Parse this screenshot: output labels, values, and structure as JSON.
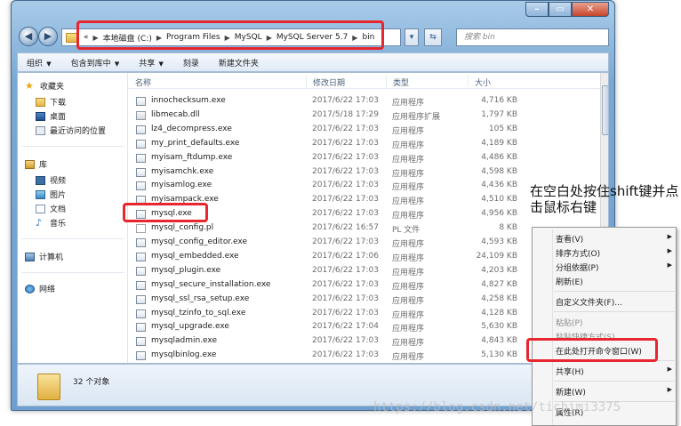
{
  "breadcrumb": [
    "本地磁盘 (C:)",
    "Program Files",
    "MySQL",
    "MySQL Server 5.7",
    "bin"
  ],
  "breadcrumb_overflow": "«",
  "search_placeholder": "搜索 bin",
  "toolbar": {
    "organize": "组织",
    "include_library": "包含到库中",
    "share": "共享",
    "burn": "刻录",
    "new_folder": "新建文件夹"
  },
  "nav": {
    "favorites": "收藏夹",
    "downloads": "下载",
    "desktop": "桌面",
    "recent": "最近访问的位置",
    "libraries": "库",
    "videos": "视频",
    "pictures": "图片",
    "documents": "文档",
    "music": "音乐",
    "computer": "计算机",
    "network": "网络"
  },
  "columns": {
    "name": "名称",
    "date": "修改日期",
    "type": "类型",
    "size": "大小"
  },
  "files": [
    {
      "name": "innochecksum.exe",
      "date": "2017/6/22 17:03",
      "type": "应用程序",
      "size": "4,716 KB",
      "icon": "exe"
    },
    {
      "name": "libmecab.dll",
      "date": "2017/5/18 17:29",
      "type": "应用程序扩展",
      "size": "1,797 KB",
      "icon": "dll"
    },
    {
      "name": "lz4_decompress.exe",
      "date": "2017/6/22 17:03",
      "type": "应用程序",
      "size": "105 KB",
      "icon": "exe"
    },
    {
      "name": "my_print_defaults.exe",
      "date": "2017/6/22 17:03",
      "type": "应用程序",
      "size": "4,189 KB",
      "icon": "exe"
    },
    {
      "name": "myisam_ftdump.exe",
      "date": "2017/6/22 17:03",
      "type": "应用程序",
      "size": "4,486 KB",
      "icon": "exe"
    },
    {
      "name": "myisamchk.exe",
      "date": "2017/6/22 17:03",
      "type": "应用程序",
      "size": "4,598 KB",
      "icon": "exe"
    },
    {
      "name": "myisamlog.exe",
      "date": "2017/6/22 17:03",
      "type": "应用程序",
      "size": "4,436 KB",
      "icon": "exe"
    },
    {
      "name": "myisampack.exe",
      "date": "2017/6/22 17:03",
      "type": "应用程序",
      "size": "4,510 KB",
      "icon": "exe"
    },
    {
      "name": "mysql.exe",
      "date": "2017/6/22 17:03",
      "type": "应用程序",
      "size": "4,956 KB",
      "icon": "exe"
    },
    {
      "name": "mysql_config.pl",
      "date": "2017/6/22 16:57",
      "type": "PL 文件",
      "size": "8 KB",
      "icon": "pl"
    },
    {
      "name": "mysql_config_editor.exe",
      "date": "2017/6/22 17:03",
      "type": "应用程序",
      "size": "4,593 KB",
      "icon": "exe"
    },
    {
      "name": "mysql_embedded.exe",
      "date": "2017/6/22 17:06",
      "type": "应用程序",
      "size": "24,109 KB",
      "icon": "exe"
    },
    {
      "name": "mysql_plugin.exe",
      "date": "2017/6/22 17:03",
      "type": "应用程序",
      "size": "4,203 KB",
      "icon": "exe"
    },
    {
      "name": "mysql_secure_installation.exe",
      "date": "2017/6/22 17:03",
      "type": "应用程序",
      "size": "4,827 KB",
      "icon": "exe"
    },
    {
      "name": "mysql_ssl_rsa_setup.exe",
      "date": "2017/6/22 17:03",
      "type": "应用程序",
      "size": "4,258 KB",
      "icon": "exe"
    },
    {
      "name": "mysql_tzinfo_to_sql.exe",
      "date": "2017/6/22 17:03",
      "type": "应用程序",
      "size": "4,128 KB",
      "icon": "exe"
    },
    {
      "name": "mysql_upgrade.exe",
      "date": "2017/6/22 17:04",
      "type": "应用程序",
      "size": "5,630 KB",
      "icon": "exe"
    },
    {
      "name": "mysqladmin.exe",
      "date": "2017/6/22 17:03",
      "type": "应用程序",
      "size": "4,843 KB",
      "icon": "exe"
    },
    {
      "name": "mysqlbinlog.exe",
      "date": "2017/6/22 17:03",
      "type": "应用程序",
      "size": "5,130 KB",
      "icon": "exe"
    }
  ],
  "status": {
    "count": "32 个对象"
  },
  "annotation": "在空白处按住shift键并点击鼠标右键",
  "context_menu": [
    {
      "label": "查看(V)",
      "submenu": true,
      "disabled": false
    },
    {
      "label": "排序方式(O)",
      "submenu": true,
      "disabled": false
    },
    {
      "label": "分组依据(P)",
      "submenu": true,
      "disabled": false
    },
    {
      "label": "刷新(E)",
      "submenu": false,
      "disabled": false
    },
    {
      "sep": true
    },
    {
      "label": "自定义文件夹(F)...",
      "submenu": false,
      "disabled": false
    },
    {
      "sep": true
    },
    {
      "label": "粘贴(P)",
      "submenu": false,
      "disabled": true
    },
    {
      "label": "粘贴快捷方式(S)",
      "submenu": false,
      "disabled": true
    },
    {
      "label": "在此处打开命令窗口(W)",
      "submenu": false,
      "disabled": false
    },
    {
      "sep": true
    },
    {
      "label": "共享(H)",
      "submenu": true,
      "disabled": false
    },
    {
      "sep": true
    },
    {
      "label": "新建(W)",
      "submenu": true,
      "disabled": false
    },
    {
      "sep": true
    },
    {
      "label": "属性(R)",
      "submenu": false,
      "disabled": false
    }
  ],
  "watermark": "https://blog.csdn.net/tichimi3375",
  "colors": {
    "highlight_box": "#e8262e",
    "window_frame": "#7aa8d4"
  }
}
